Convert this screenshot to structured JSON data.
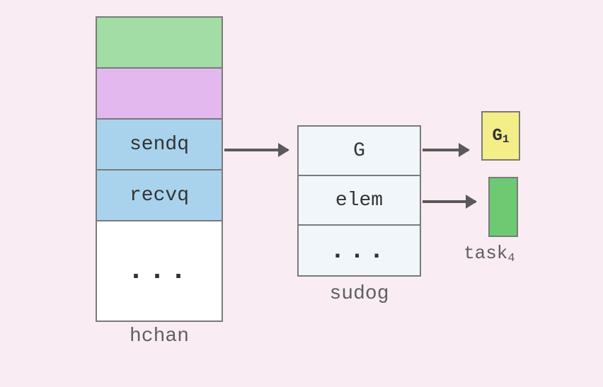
{
  "hchan": {
    "label": "hchan",
    "cells": {
      "sendq": "sendq",
      "recvq": "recvq",
      "ellipsis": "..."
    }
  },
  "sudog": {
    "label": "sudog",
    "cells": {
      "g": "G",
      "elem": "elem",
      "ellipsis": "..."
    }
  },
  "g1": {
    "prefix": "G",
    "sub": "1"
  },
  "task": {
    "prefix": "task",
    "sub": "4"
  }
}
